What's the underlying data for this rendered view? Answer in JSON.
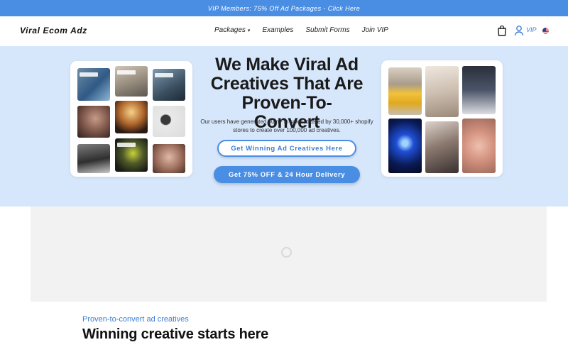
{
  "announcement": "VIP Members: 75% Off Ad Packages - Click Here",
  "brand": "Viral Ecom Adz",
  "nav": [
    {
      "label": "Packages",
      "dropdown": true
    },
    {
      "label": "Examples"
    },
    {
      "label": "Submit Forms"
    },
    {
      "label": "Join VIP"
    }
  ],
  "header_icons": {
    "cart": "cart-icon",
    "account": "user-icon",
    "vip_label": "VIP",
    "locale": "us-flag-icon"
  },
  "hero": {
    "title": "We Make Viral Ad Creatives That Are Proven-To-Convert",
    "subtitle": "Our users have generated 30m+ in sales, trusted by 30,000+ shopify stores to create over 100,000 ad creatives.",
    "primary_button": "Get Winning Ad Creatives Here",
    "secondary_button": "Get 75% OFF & 24 Hour Delivery"
  },
  "colors": {
    "accent": "#4a8ee4",
    "hero_bg": "#d6e6fb"
  },
  "section": {
    "eyebrow": "Proven-to-convert ad creatives",
    "title": "Winning creative starts here"
  }
}
